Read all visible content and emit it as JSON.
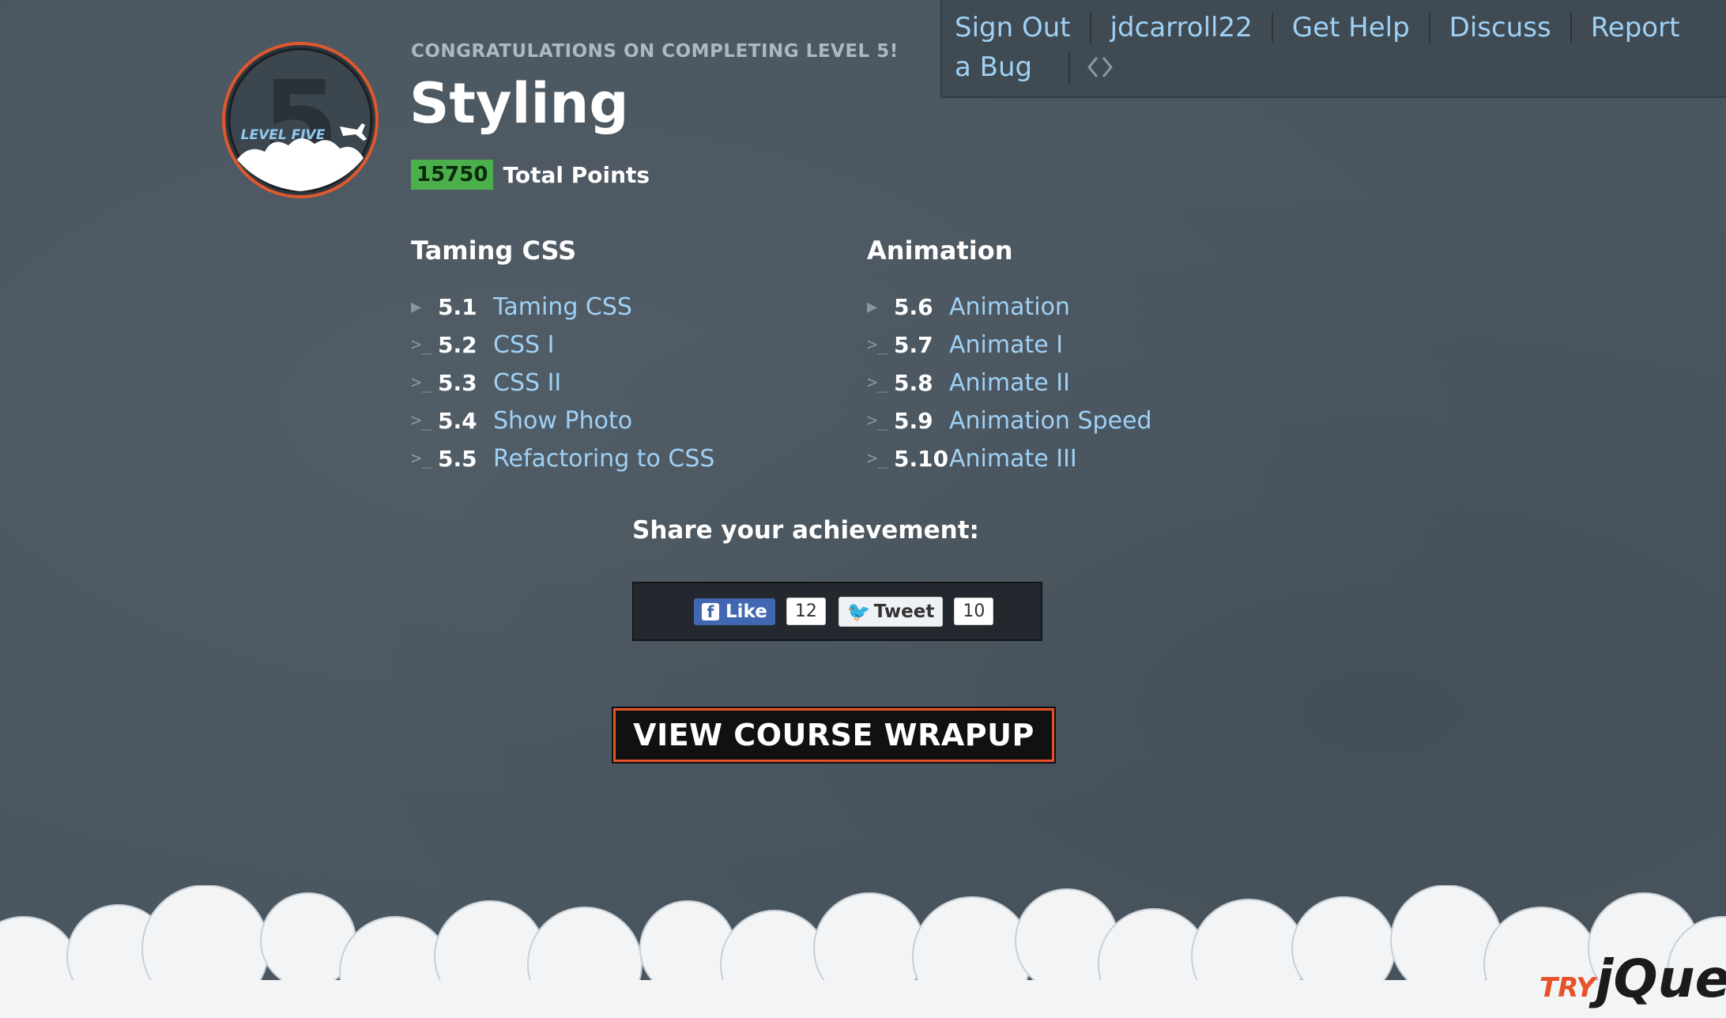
{
  "nav": {
    "links": [
      "Sign Out",
      "jdcarroll22",
      "Get Help",
      "Discuss",
      "Report a Bug"
    ],
    "sign_out": "Sign Out",
    "user": "jdcarroll22",
    "get_help": "Get Help",
    "discuss": "Discuss",
    "report": "Report",
    "a_bug": "a Bug",
    "code_icon": "code-brackets-icon"
  },
  "badge": {
    "label": "LEVEL FIVE",
    "number": "5",
    "icon": "airplane-icon"
  },
  "header": {
    "congrats": "CONGRATULATIONS ON COMPLETING LEVEL 5!",
    "title": "Styling",
    "points": "15750",
    "points_label": "Total Points"
  },
  "sections": [
    {
      "title": "Taming CSS",
      "items": [
        {
          "icon": "play-icon",
          "num": "5.1",
          "label": "Taming CSS"
        },
        {
          "icon": "console-icon",
          "num": "5.2",
          "label": "CSS I"
        },
        {
          "icon": "console-icon",
          "num": "5.3",
          "label": "CSS II"
        },
        {
          "icon": "console-icon",
          "num": "5.4",
          "label": "Show Photo"
        },
        {
          "icon": "console-icon",
          "num": "5.5",
          "label": "Refactoring to CSS"
        }
      ]
    },
    {
      "title": "Animation",
      "items": [
        {
          "icon": "play-icon",
          "num": "5.6",
          "label": "Animation"
        },
        {
          "icon": "console-icon",
          "num": "5.7",
          "label": "Animate I"
        },
        {
          "icon": "console-icon",
          "num": "5.8",
          "label": "Animate II"
        },
        {
          "icon": "console-icon",
          "num": "5.9",
          "label": "Animation Speed"
        },
        {
          "icon": "console-icon",
          "num": "5.10",
          "label": "Animate III"
        }
      ]
    }
  ],
  "share": {
    "title": "Share your achievement:",
    "like_label": "Like",
    "like_count": "12",
    "tweet_label": "Tweet",
    "tweet_count": "10"
  },
  "wrapup_button": "VIEW COURSE WRAPUP",
  "brand": {
    "try": "TRY",
    "name": "jQuer"
  },
  "colors": {
    "background": "#4a5660",
    "link": "#9fd1f5",
    "points_bg": "#4bb04b",
    "accent": "#e8522b"
  }
}
